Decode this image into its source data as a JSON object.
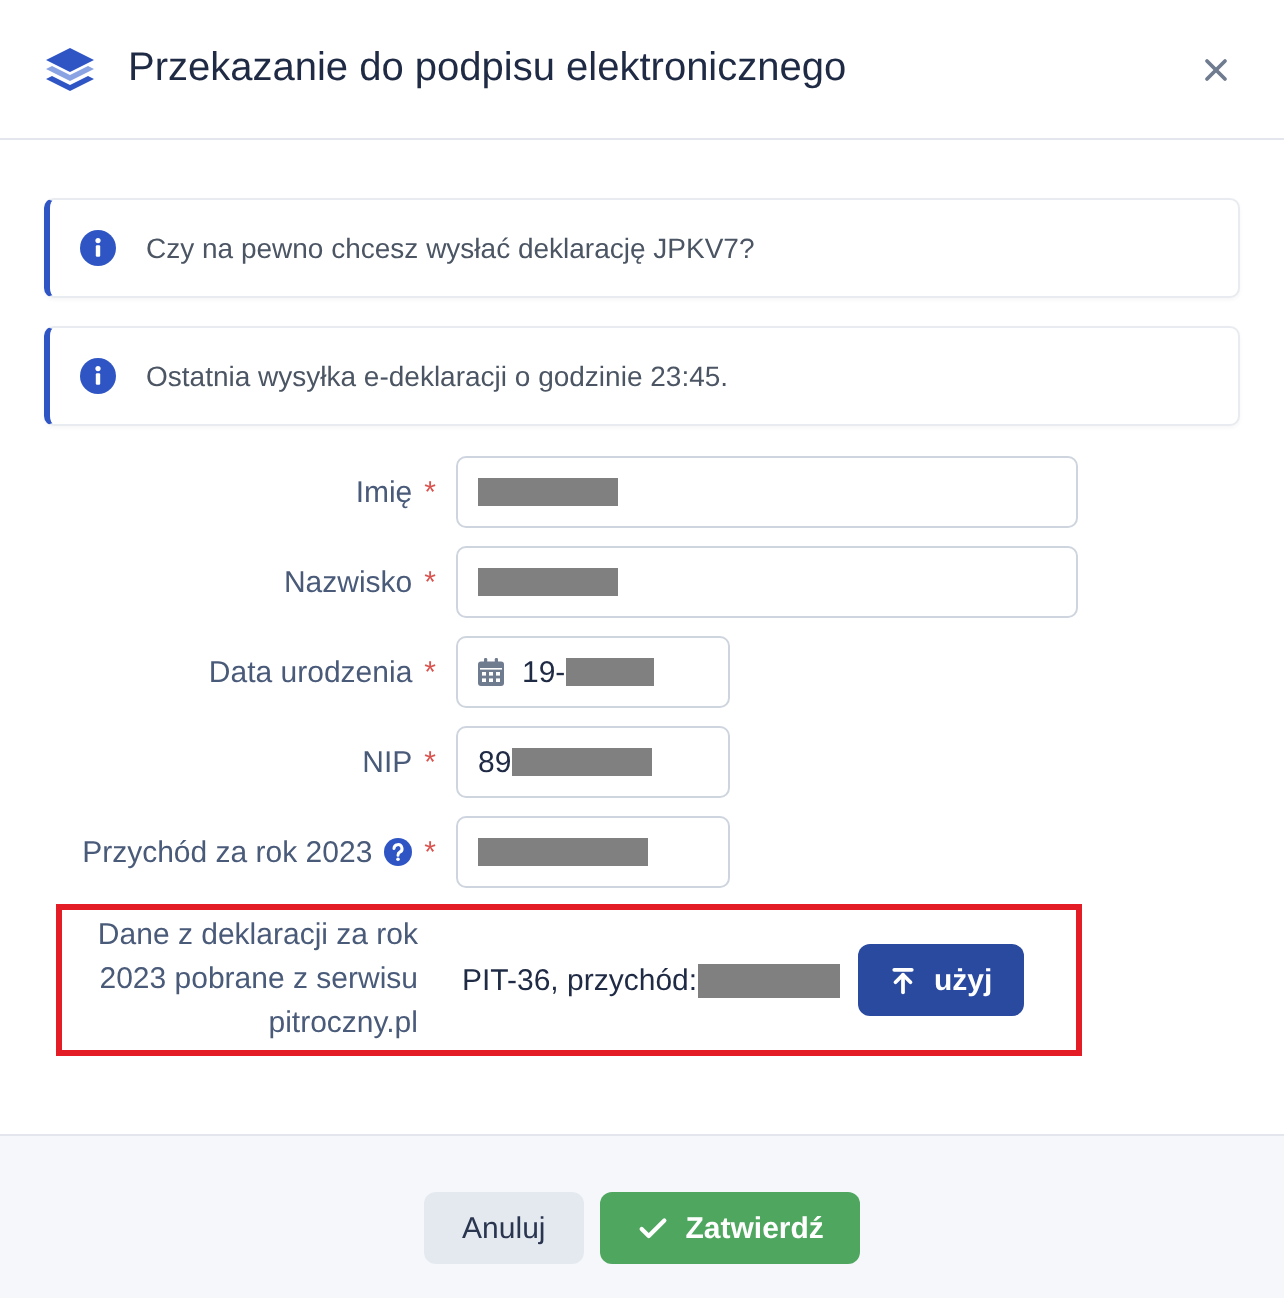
{
  "dialog": {
    "title": "Przekazanie do podpisu elektronicznego"
  },
  "alerts": [
    {
      "kind": "info",
      "text": "Czy na pewno chcesz wysłać deklarację JPKV7?"
    },
    {
      "kind": "info",
      "text": "Ostatnia wysyłka e-deklaracji o godzinie 23:45."
    }
  ],
  "form": {
    "required_marker": "*",
    "fields": [
      {
        "kind": "text",
        "label": "Imię",
        "required": true,
        "help": false,
        "redacted": true
      },
      {
        "kind": "text",
        "label": "Nazwisko",
        "required": true,
        "help": false,
        "redacted": true
      },
      {
        "kind": "date",
        "label": "Data urodzenia",
        "required": true,
        "help": false,
        "value": "19-",
        "redacted": true
      },
      {
        "kind": "number",
        "label": "NIP",
        "required": true,
        "help": false,
        "value": "89",
        "redacted": true
      },
      {
        "kind": "amount",
        "label": "Przychód za rok 2023",
        "required": true,
        "help": true,
        "redacted": true
      }
    ]
  },
  "import": {
    "highlighted": true,
    "label": "Dane z deklaracji za rok 2023 pobrane z serwisu pitroczny.pl",
    "text": "PIT-36, przychód:",
    "redacted": true,
    "button": "użyj"
  },
  "footer": {
    "buttons": [
      {
        "kind": "secondary",
        "label": "Anuluj"
      },
      {
        "kind": "primary",
        "label": "Zatwierdź"
      }
    ]
  }
}
